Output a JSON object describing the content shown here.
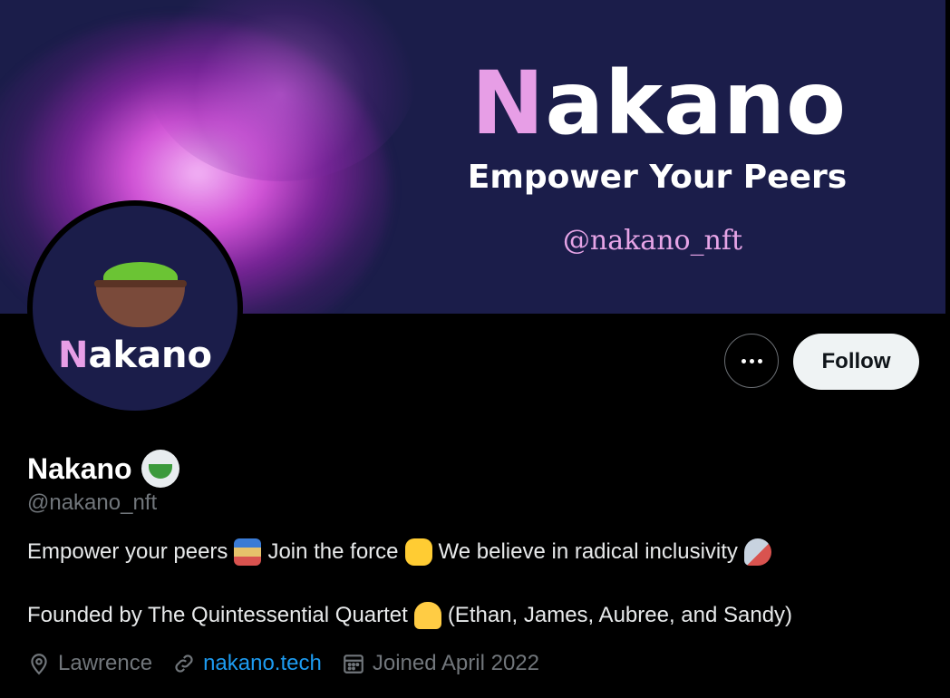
{
  "banner": {
    "title_initial": "N",
    "title_rest": "akano",
    "subtitle": "Empower Your Peers",
    "handle": "@nakano_nft"
  },
  "avatar": {
    "text_initial": "N",
    "text_rest": "akano"
  },
  "actions": {
    "more_label": "More",
    "follow_label": "Follow"
  },
  "profile": {
    "name": "Nakano",
    "handle": "@nakano_nft",
    "bio_line1": [
      "Empower your peers",
      "Join the force",
      "We believe in radical inclusivity"
    ],
    "bio_line2": [
      "Founded by The Quintessential Quartet",
      "(Ethan, James, Aubree, and Sandy)"
    ],
    "location": "Lawrence",
    "website": "nakano.tech",
    "joined": "Joined April 2022"
  },
  "colors": {
    "banner_bg": "#1b1d4a",
    "accent_pink": "#e79ee6",
    "link_blue": "#1d9bf0",
    "muted_gray": "#71767b"
  },
  "icons": [
    "location-pin-icon",
    "link-icon",
    "calendar-icon",
    "more-dots-icon",
    "matcha-emoji-icon"
  ]
}
